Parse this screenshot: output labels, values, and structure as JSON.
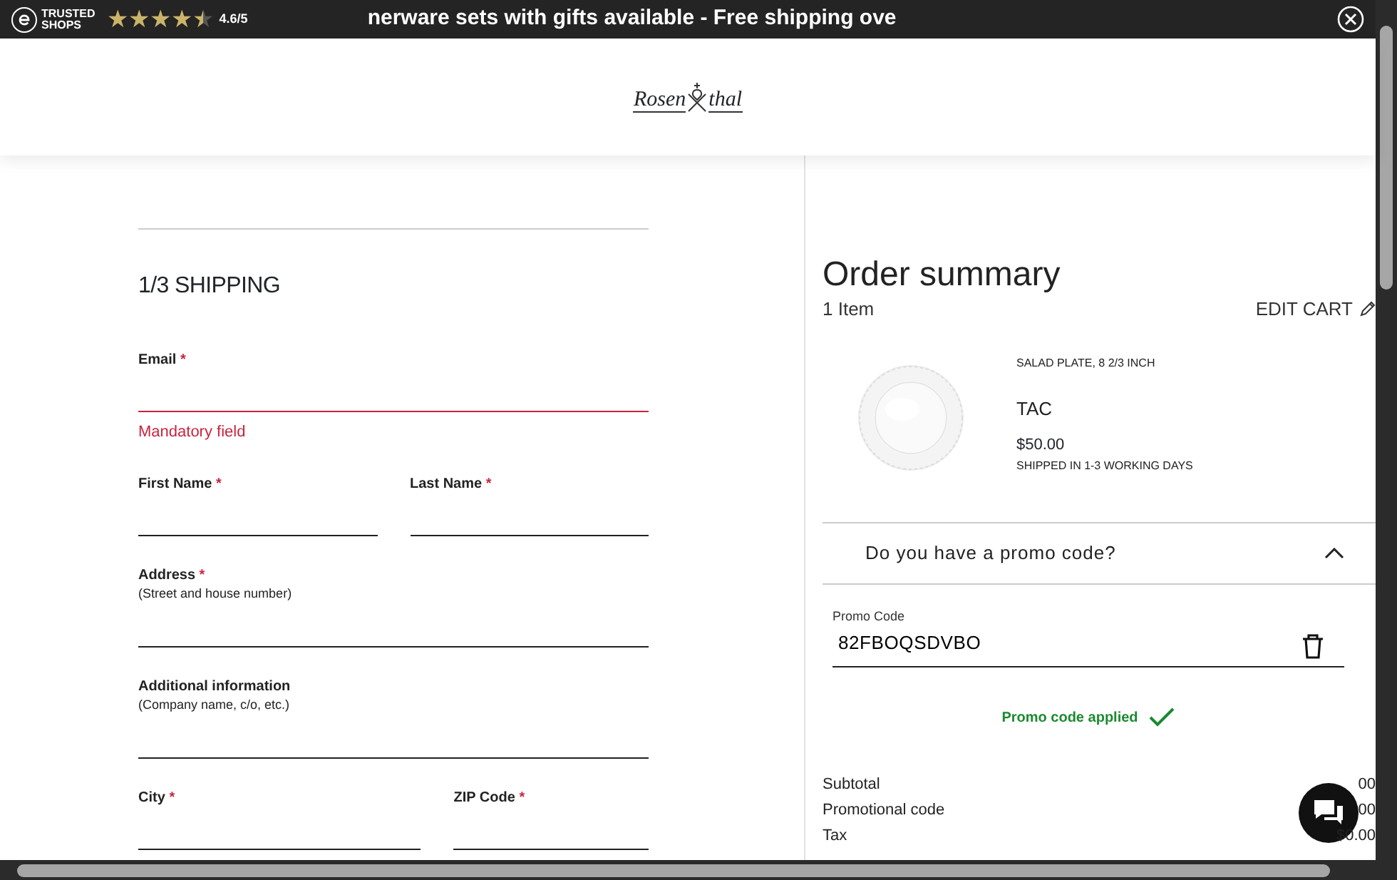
{
  "top_bar": {
    "badge_lines": [
      "TRUSTED",
      "SHOPS"
    ],
    "stars": 4.5,
    "rating": "4.6/5",
    "announcement": "nerware sets with gifts available - Free shipping ove"
  },
  "logo": [
    "Rosen",
    "thal"
  ],
  "checkout": {
    "step": "1/3 SHIPPING",
    "rows": [
      [
        {
          "label": "Email",
          "mark": "*",
          "error": "Mandatory field"
        }
      ],
      [
        {
          "label": "First Name",
          "mark": "*"
        },
        {
          "label": "Last Name",
          "mark": "*"
        }
      ],
      [
        {
          "label": "Address",
          "mark": "*",
          "hint": "(Street and house number)"
        }
      ],
      [
        {
          "label": "Additional information",
          "hint": "(Company name, c/o, etc.)"
        }
      ],
      [
        {
          "label": "City",
          "mark": "*",
          "wide": true
        },
        {
          "label": "ZIP Code",
          "mark": "*"
        }
      ]
    ]
  },
  "summary": {
    "title": "Order summary",
    "count": "1 Item",
    "edit": "EDIT CART",
    "items": [
      {
        "kind": "picture",
        "name": "SALAD PLATE, 8 2/3 INCH",
        "collection": "TAC",
        "price": "$50.00",
        "shipping": "SHIPPED IN 1-3 WORKING DAYS"
      }
    ]
  },
  "promo": {
    "question": "Do you have a promo code?",
    "expanded": true,
    "label": "Promo Code",
    "value": "82FBOQSDVBO",
    "status": "Promo code applied"
  },
  "totals": [
    {
      "label": "Subtotal",
      "value": "00"
    },
    {
      "label": "Promotional code",
      "value": "00"
    },
    {
      "label": "Tax",
      "value": "$0.00"
    }
  ]
}
